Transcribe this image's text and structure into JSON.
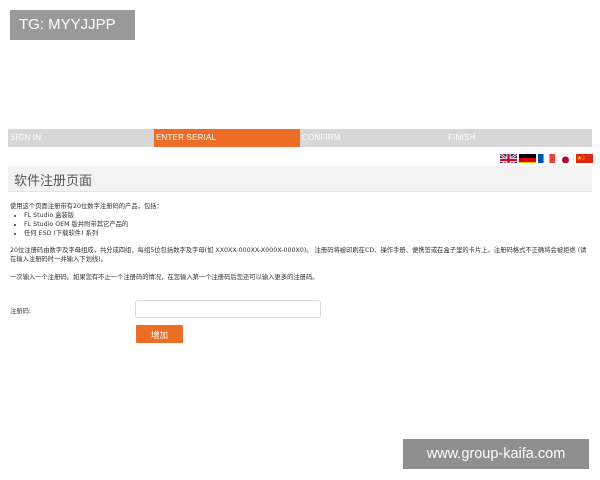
{
  "tag": {
    "text": "TG: MYYJJPP"
  },
  "watermark": {
    "text": "www.group-kaifa.com"
  },
  "steps": [
    {
      "label": "SIGN IN",
      "active": false
    },
    {
      "label": "ENTER SERIAL",
      "active": true
    },
    {
      "label": "CONFIRM",
      "active": false
    },
    {
      "label": "FINISH",
      "active": false
    }
  ],
  "flags": [
    "uk-flag",
    "germany-flag",
    "france-flag",
    "japan-flag",
    "china-flag"
  ],
  "page": {
    "title": "软件注册页面",
    "intro": "使用这个页面注册带有20位数字注册码的产品，包括：",
    "products": [
      "FL Studio 盒装版",
      "FL Studio OEM 版并附带其它产品的",
      "任何 ESD (下载软件) 系列"
    ],
    "format_note": "20位注册码由数字及字母组成，共分成四组，每组5位包括数字及字母(如 XX0XX-000XX-X000X-000X0)。 注册码将被印刷在CD、操作手册、便携签或在盒子里的卡片上。注册码格式不正确将会被拒绝 (请在输入注册码时一并输入下划线)。",
    "multi_note": "一次输入一个注册码。如果您有不止一个注册码的情况，在您输入第一个注册码后您还可以输入更多的注册码。"
  },
  "form": {
    "serial_label": "注册码:",
    "serial_value": "",
    "add_label": "增加"
  },
  "colors": {
    "accent": "#ee6d26",
    "step_bg": "#d7d7d7"
  }
}
